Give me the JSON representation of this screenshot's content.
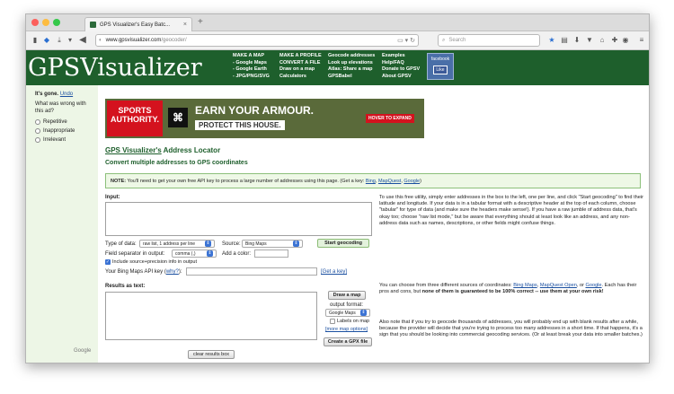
{
  "browser": {
    "tab_title": "GPS Visualizer's Easy Batc...",
    "tab_close": "×",
    "new_tab": "+",
    "url_host": "www.gpsvisualizer.com",
    "url_path": "/geocoder/",
    "search_placeholder": "Search"
  },
  "header": {
    "logo": "GPSVisualizer",
    "col1": [
      "MAKE A MAP",
      "- Google Maps",
      "- Google Earth",
      "- JPG/PNG/SVG"
    ],
    "col2": [
      "MAKE A PROFILE",
      "CONVERT A FILE",
      "Draw on a map",
      "Calculators"
    ],
    "col3": [
      "Geocode addresses",
      "Look up elevations",
      "Atlas: Share a map",
      "GPSBabel"
    ],
    "col4": [
      "Examples",
      "Help/FAQ",
      "Donate to GPSV",
      "About GPSV"
    ],
    "fb_label": "facebook",
    "fb_like": "Like"
  },
  "sidebar": {
    "gone": "It's gone.",
    "undo": "Undo",
    "question": "What was wrong with this ad?",
    "options": [
      "Repetitive",
      "Inappropriate",
      "Irrelevant"
    ],
    "google": "Google"
  },
  "ad": {
    "brand": "SPORTS AUTHORITY.",
    "headline": "EARN YOUR ARMOUR.",
    "sub": "PROTECT THIS HOUSE.",
    "cta": "HOVER TO EXPAND"
  },
  "main": {
    "title_link": "GPS Visualizer's",
    "title_rest": " Address Locator",
    "subtitle": "Convert multiple addresses to GPS coordinates",
    "note_prefix": "NOTE:",
    "note_text": " You'll need to get your own free API key to process a large number of addresses using this page. (Get a key: ",
    "note_links": [
      "Bing",
      "MapQuest",
      "Google"
    ],
    "note_end": ")",
    "input_label": "Input:",
    "type_label": "Type of data:",
    "type_value": "raw list, 1 address per line",
    "source_label": "Source:",
    "source_value": "Bing Maps",
    "start_button": "Start geocoding",
    "sep_label": "Field separator in output:",
    "sep_value": "comma (,)",
    "color_label": "Add a color:",
    "include_label": "Include source+precision info in output",
    "apikey_label": "Your Bing Maps API key",
    "apikey_why": "why?",
    "getkey": "[Get a key]",
    "results_label": "Results as text:",
    "draw_button": "Draw a map",
    "output_format_label": "output format:",
    "output_format_value": "Google Maps",
    "labels_on_map": "Labels on map",
    "more_options": "[more map options]",
    "gpx_button": "Create a GPX file",
    "clear_button": "clear results box"
  },
  "help": {
    "p1": "To use this free utility, simply enter addresses in the box to the left, one per line, and click \"Start geocoding\" to find their latitude and longitude. If your data is in a tabular format with a descriptive header at the top of each column, choose \"tabular\" for type of data (and make sure the headers make sense!). If you have a raw jumble of address data, that's okay too; choose \"raw list mode,\" but be aware that everything should at least look like an address, and any non-address data such as names, descriptions, or other fields might confuse things.",
    "p2_a": "You can choose from three different sources of coordinates: ",
    "p2_links": [
      "Bing Maps",
      "MapQuest Open",
      "Google"
    ],
    "p2_b": ". Each has their pros and cons, but ",
    "p2_bold": "none of them is guaranteed to be 100% correct -- use them at your own risk!",
    "p3": "Also note that if you try to geocode thousands of addresses, you will probably end up with blank results after a while, because the provider will decide that you're trying to process too many addresses in a short time. If that happens, it's a sign that you should be looking into commercial geocoding services. (Or at least break your data into smaller batches.)"
  }
}
